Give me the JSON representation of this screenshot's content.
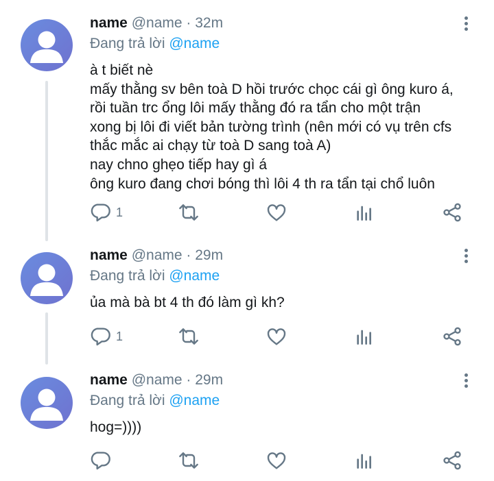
{
  "tweets": [
    {
      "name": "name",
      "handle": "@name",
      "time": "32m",
      "replying_to": "Đang trả lời",
      "mention": "@name",
      "text": "à t biết nè\nmấy thằng sv bên toà D hồi trước chọc cái gì ông kuro á,\nrồi tuần trc ổng lôi mấy thằng đó ra tẩn cho một trận\nxong bị lôi đi viết bản tường trình (nên mới có vụ trên cfs\nthắc mắc ai chạy từ toà D sang toà A)\nnay chno ghẹo tiếp hay gì á\nông kuro đang chơi bóng thì lôi 4 th ra tẩn tại chổ luôn",
      "reply_count": "1",
      "icons": [
        "reply-icon",
        "retweet-icon",
        "like-icon",
        "analytics-icon",
        "share-icon"
      ]
    },
    {
      "name": "name",
      "handle": "@name",
      "time": "29m",
      "replying_to": "Đang trả lời",
      "mention": "@name",
      "text": "ủa mà bà bt 4 th đó làm gì kh?",
      "reply_count": "1",
      "icons": [
        "reply-icon",
        "retweet-icon",
        "like-icon",
        "analytics-icon",
        "share-icon"
      ]
    },
    {
      "name": "name",
      "handle": "@name",
      "time": "29m",
      "replying_to": "Đang trả lời",
      "mention": "@name",
      "text": "hog=))))",
      "reply_count": "",
      "icons": [
        "reply-icon",
        "retweet-icon",
        "like-icon",
        "analytics-icon",
        "share-icon"
      ]
    }
  ],
  "separator": "·",
  "colors": {
    "name": "#14171a",
    "meta": "#657786",
    "mention": "#1da1f2",
    "avatar": "#6a7fd8",
    "thread_line": "#dfe3e7"
  }
}
